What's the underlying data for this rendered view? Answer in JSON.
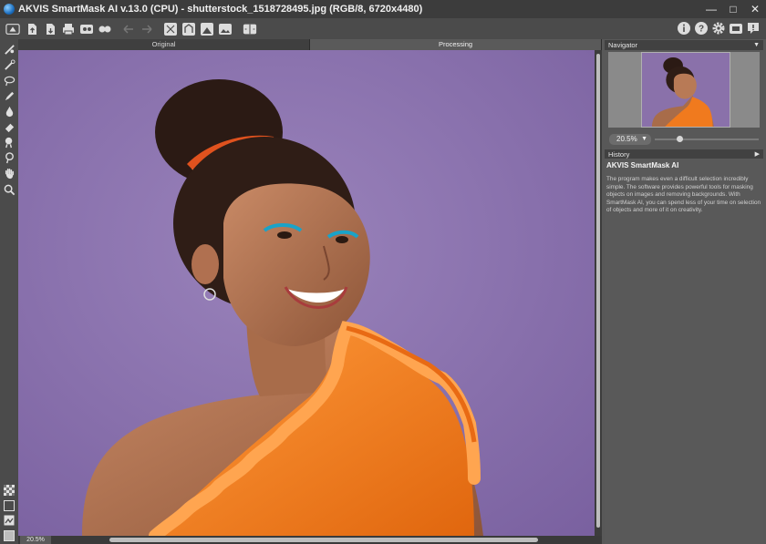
{
  "window": {
    "title": "AKVIS SmartMask AI v.13.0 (CPU) - shutterstock_1518728495.jpg (RGB/8, 6720x4480)",
    "controls": [
      "minimize",
      "maximize",
      "close"
    ]
  },
  "toolbar": {
    "left_icons": [
      "home-icon",
      "open-file-icon",
      "save-file-icon",
      "print-icon",
      "batch-icon",
      "share-icon",
      "undo-icon",
      "redo-icon",
      "run-icon",
      "cut-icon",
      "background-icon",
      "image-icon",
      "compare-icon"
    ],
    "right_icons": [
      "info-icon",
      "help-icon",
      "settings-icon",
      "plugin-icon",
      "news-icon"
    ]
  },
  "tabs": [
    {
      "label": "Original",
      "active": false
    },
    {
      "label": "Processing",
      "active": true
    }
  ],
  "tools": [
    "select-brush-icon",
    "magic-brush-icon",
    "lasso-icon",
    "pen-icon",
    "drop-icon",
    "eraser-icon",
    "stamp-icon",
    "chromakey-icon",
    "hand-icon",
    "zoom-icon"
  ],
  "status": {
    "zoom": "20.5%"
  },
  "navigator": {
    "header": "Navigator",
    "zoom_value": "20.5%",
    "zoom_slider_fraction": 0.24
  },
  "history": {
    "header": "History",
    "title": "AKVIS SmartMask AI",
    "description": "The program makes even a difficult selection incredibly simple. The software provides powerful tools for masking objects on images and removing backgrounds. With SmartMask AI, you can spend less of your time on selection of objects and more of it on creativity."
  },
  "colors": {
    "background_purple": "#8a71aa",
    "shirt_orange": "#f07a1e",
    "panel_dark": "#3c3c3c"
  }
}
